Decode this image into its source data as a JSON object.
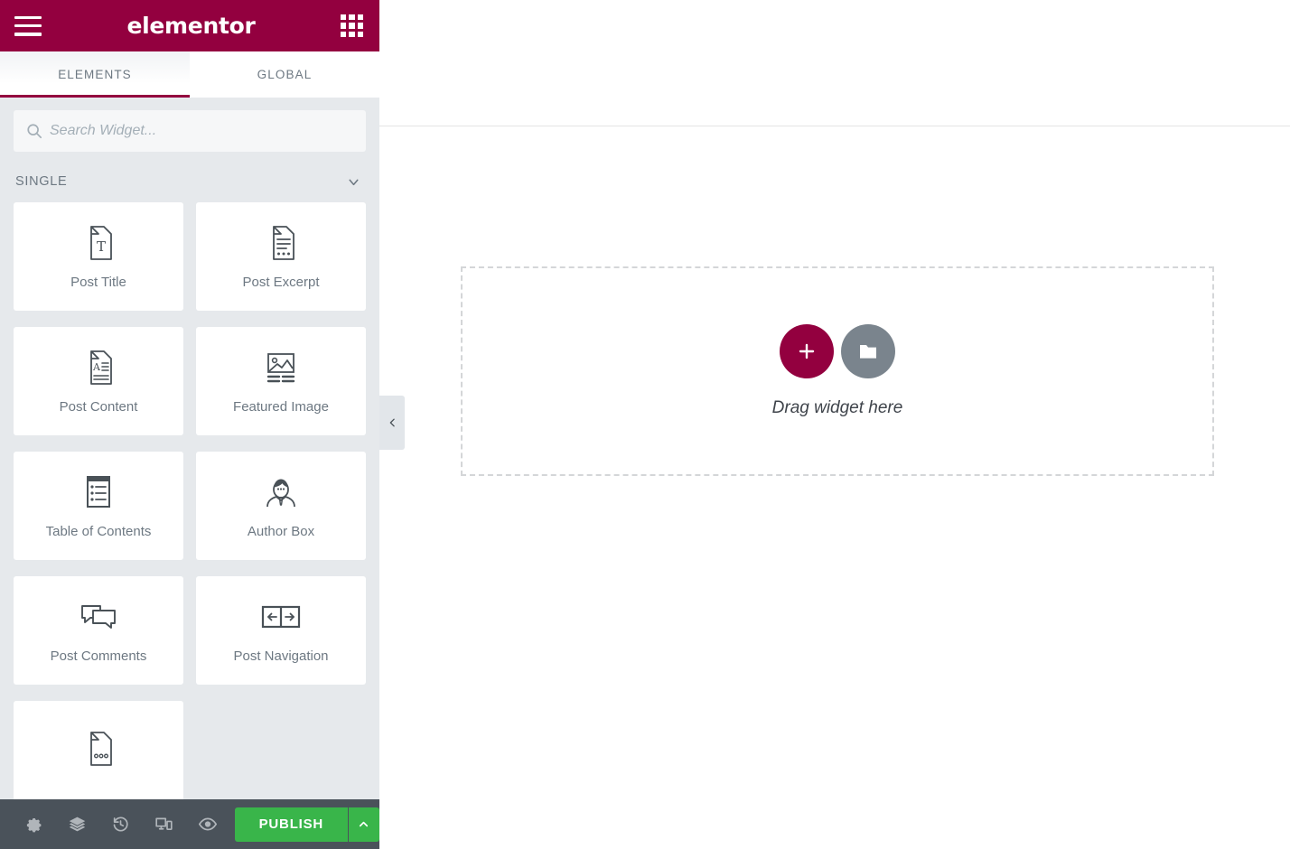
{
  "panel": {
    "header": {
      "menu_icon": "hamburger-menu-icon",
      "logo": "elementor",
      "apps_icon": "grid-apps-icon",
      "background": "#93003f"
    },
    "tabs": [
      {
        "label": "ELEMENTS",
        "active": true
      },
      {
        "label": "GLOBAL",
        "active": false
      }
    ],
    "search": {
      "icon": "search-icon",
      "value": "",
      "placeholder": "Search Widget..."
    },
    "section": {
      "title": "SINGLE",
      "toggle_icon": "chevron-down-icon",
      "expanded": true
    },
    "widgets": [
      {
        "label": "Post Title",
        "icon": "post-title-icon"
      },
      {
        "label": "Post Excerpt",
        "icon": "post-excerpt-icon"
      },
      {
        "label": "Post Content",
        "icon": "post-content-icon"
      },
      {
        "label": "Featured Image",
        "icon": "featured-image-icon"
      },
      {
        "label": "Table of Contents",
        "icon": "table-of-contents-icon"
      },
      {
        "label": "Author Box",
        "icon": "author-box-icon"
      },
      {
        "label": "Post Comments",
        "icon": "post-comments-icon"
      },
      {
        "label": "Post Navigation",
        "icon": "post-navigation-icon"
      },
      {
        "label": "",
        "icon": "post-info-icon"
      }
    ],
    "footer": {
      "tools": [
        {
          "name": "settings-icon",
          "title": "Settings"
        },
        {
          "name": "layers-icon",
          "title": "Navigator"
        },
        {
          "name": "history-icon",
          "title": "History"
        },
        {
          "name": "responsive-icon",
          "title": "Responsive Mode"
        },
        {
          "name": "eye-icon",
          "title": "Preview Changes"
        }
      ],
      "publish_label": "PUBLISH",
      "publish_color": "#39b54a",
      "publish_arrow_icon": "chevron-up-icon"
    },
    "collapse_handle_icon": "chevron-left-icon"
  },
  "canvas": {
    "drop_zone": {
      "add_icon": "plus-icon",
      "folder_icon": "folder-icon",
      "label": "Drag widget here"
    }
  }
}
